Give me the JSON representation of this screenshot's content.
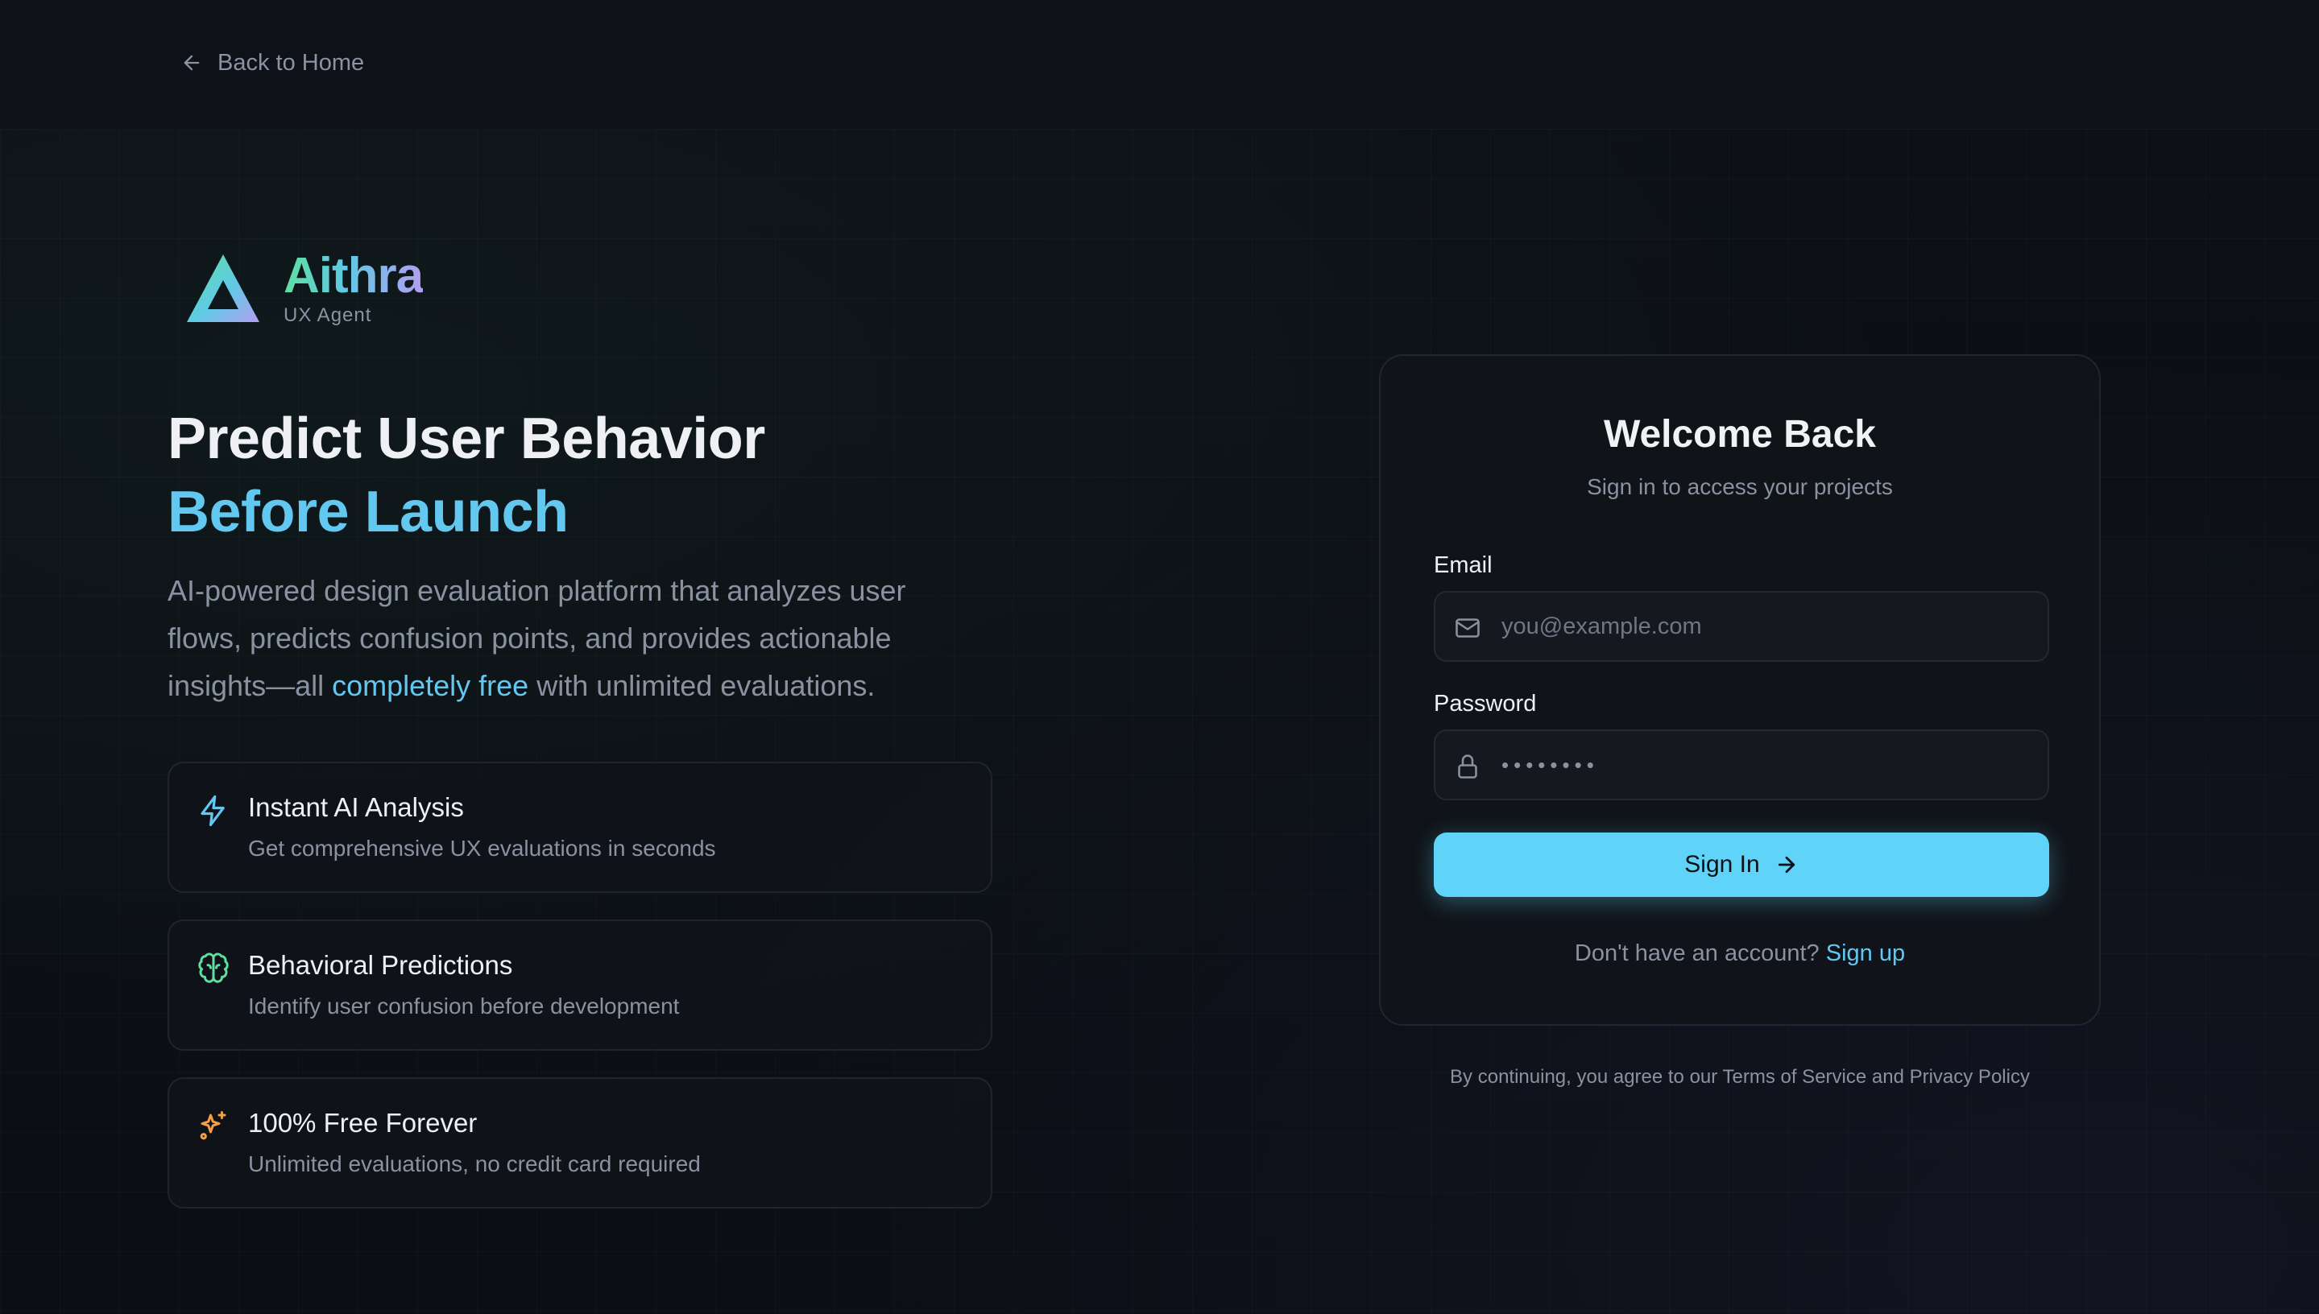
{
  "nav": {
    "back_label": "Back to Home"
  },
  "brand": {
    "name": "Aithra",
    "tagline": "UX Agent"
  },
  "hero": {
    "title_line1": "Predict User Behavior",
    "title_line2": "Before Launch",
    "description_before": "AI-powered design evaluation platform that analyzes user flows, predicts confusion points, and provides actionable insights—all ",
    "description_highlight": "completely free",
    "description_after": " with unlimited evaluations."
  },
  "features": [
    {
      "icon": "lightning-icon",
      "title": "Instant AI Analysis",
      "description": "Get comprehensive UX evaluations in seconds"
    },
    {
      "icon": "brain-icon",
      "title": "Behavioral Predictions",
      "description": "Identify user confusion before development"
    },
    {
      "icon": "sparkles-icon",
      "title": "100% Free Forever",
      "description": "Unlimited evaluations, no credit card required"
    }
  ],
  "login": {
    "title": "Welcome Back",
    "subtitle": "Sign in to access your projects",
    "email_label": "Email",
    "email_placeholder": "you@example.com",
    "password_label": "Password",
    "password_value": "••••••••",
    "submit_label": "Sign In",
    "signup_prompt": "Don't have an account?",
    "signup_link": "Sign up"
  },
  "footer": {
    "terms_text": "By continuing, you agree to our Terms of Service and Privacy Policy"
  },
  "colors": {
    "accent": "#60d4f8",
    "background": "#0c0f14",
    "muted_text": "#8a92a1",
    "lightning": "#62c8f0",
    "brain": "#5fdfa0",
    "sparkles": "#f0a04b"
  }
}
